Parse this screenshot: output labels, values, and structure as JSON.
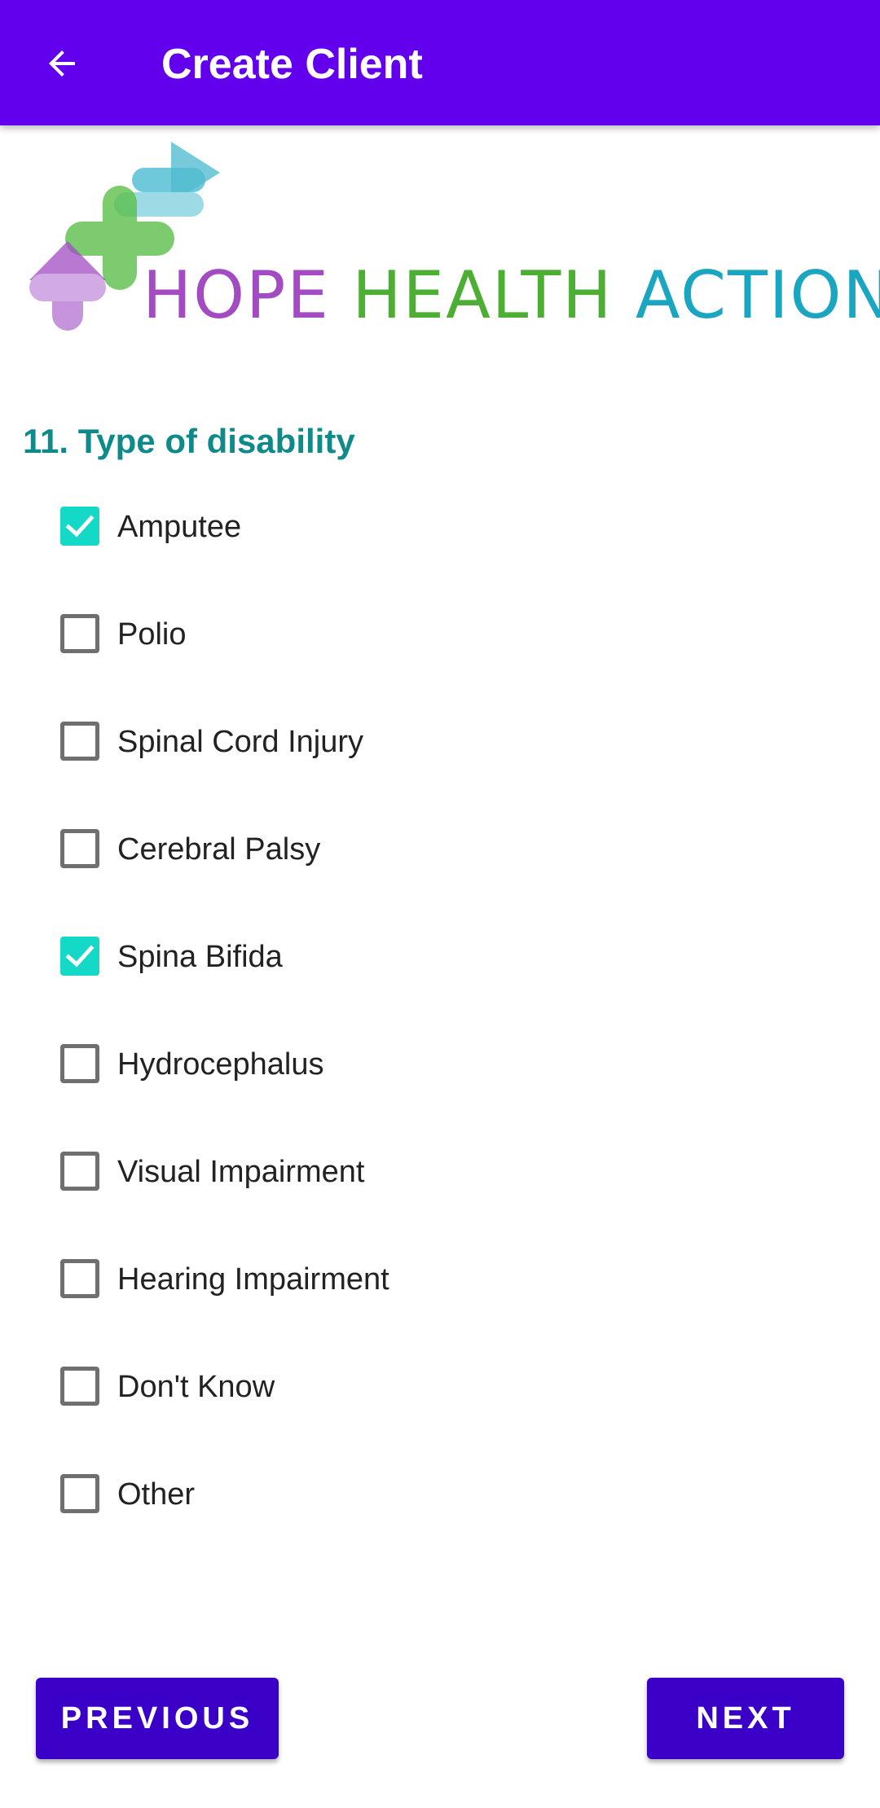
{
  "app_bar": {
    "title": "Create Client",
    "back_icon": "arrow-back-icon",
    "background": "#6200EE"
  },
  "logo": {
    "text_hope": "HOPE",
    "text_health": "HEALTH",
    "text_action": "ACTION",
    "colors": {
      "hope": "#A24BC2",
      "health": "#4CAF34",
      "action": "#1AA6C0"
    }
  },
  "question": {
    "label": "11. Type of disability",
    "color": "#0E8A8A"
  },
  "options": [
    {
      "label": "Amputee",
      "checked": true
    },
    {
      "label": "Polio",
      "checked": false
    },
    {
      "label": "Spinal Cord Injury",
      "checked": false
    },
    {
      "label": "Cerebral Palsy",
      "checked": false
    },
    {
      "label": "Spina Bifida",
      "checked": true
    },
    {
      "label": "Hydrocephalus",
      "checked": false
    },
    {
      "label": "Visual Impairment",
      "checked": false
    },
    {
      "label": "Hearing Impairment",
      "checked": false
    },
    {
      "label": "Don't Know",
      "checked": false
    },
    {
      "label": "Other",
      "checked": false
    }
  ],
  "checkbox_checked_color": "#14D9C7",
  "buttons": {
    "previous": "PREVIOUS",
    "next": "NEXT",
    "color": "#3A00C8"
  }
}
